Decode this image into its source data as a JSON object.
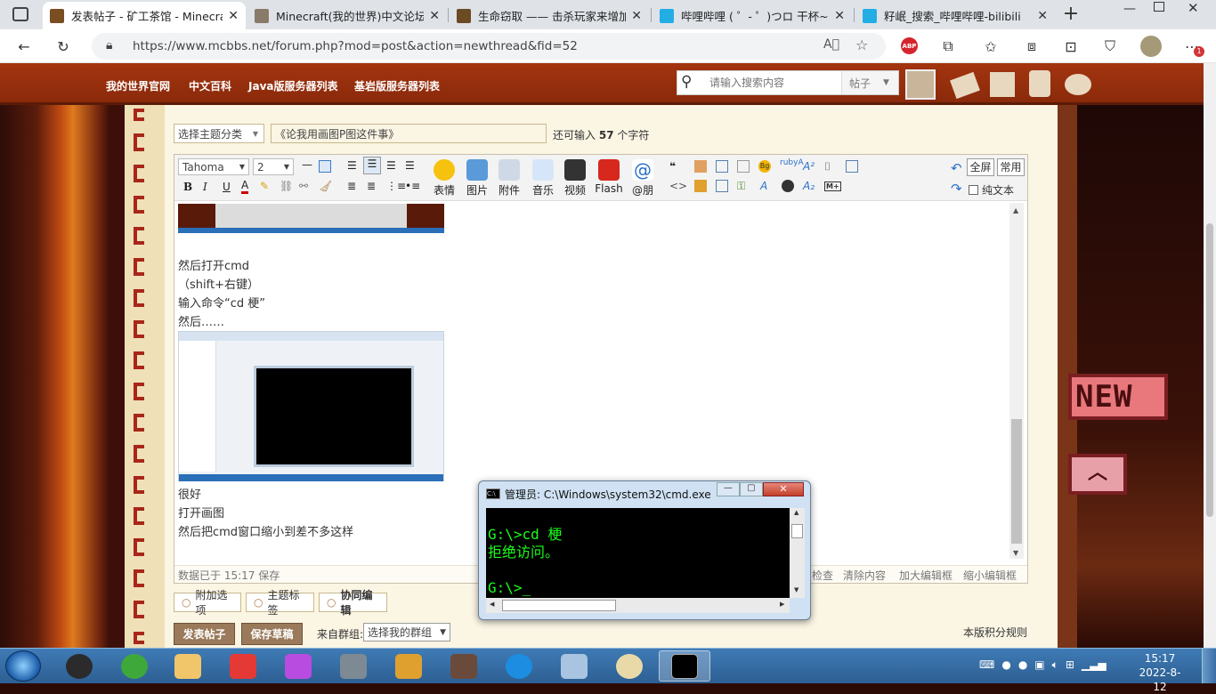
{
  "browser": {
    "tabs": [
      {
        "title": "发表帖子 - 矿工茶馆 - Minecra",
        "color": "#7a4e22",
        "active": true
      },
      {
        "title": "Minecraft(我的世界)中文论坛 -",
        "color": "#8a7a6a",
        "active": false
      },
      {
        "title": "生命窃取 —— 击杀玩家来增加",
        "color": "#6b4a24",
        "active": false
      },
      {
        "title": "哔哩哔哩 ( ゜- ゜)つロ 干杯~-b",
        "color": "#23ade5",
        "active": false
      },
      {
        "title": "籽岷_搜索_哔哩哔哩-bilibili",
        "color": "#23ade5",
        "active": false
      }
    ],
    "url": "https://www.mcbbs.net/forum.php?mod=post&action=newthread&fid=52",
    "abp_label": "ABP",
    "notif_count": "1"
  },
  "site": {
    "nav": [
      "我的世界官网",
      "中文百科",
      "Java版服务器列表",
      "基岩版服务器列表"
    ],
    "search_placeholder": "请输入搜索内容",
    "search_scope": "帖子"
  },
  "post": {
    "category_select": "选择主题分类",
    "subject": "《论我用画图P图这件事》",
    "remaining_prefix": "还可输入",
    "remaining_count": "57",
    "remaining_suffix": "个字符"
  },
  "toolbar": {
    "font_name": "Tahoma",
    "font_size": "2",
    "big_buttons": [
      "表情",
      "图片",
      "附件",
      "音乐",
      "视频",
      "Flash",
      "@朋"
    ],
    "fullscreen": "全屏",
    "common": "常用",
    "plaintext": "纯文本",
    "bold": "B",
    "italic": "I",
    "underline": "U",
    "color_a": "A"
  },
  "editor_body": {
    "lines_1": [
      "然后打开cmd",
      "（shift+右键）",
      "输入命令“cd 梗”",
      "然后……"
    ],
    "lines_2": [
      "很好",
      "打开画图",
      "然后把cmd窗口缩小到差不多这样"
    ]
  },
  "status": {
    "autosave": "数据已于 15:17 保存",
    "check": "检查",
    "clear": "清除内容",
    "enlarge": "加大编辑框",
    "shrink": "缩小编辑框"
  },
  "options": {
    "extra": "附加选项",
    "tags": "主题标签",
    "collab": "协同编辑"
  },
  "actions": {
    "submit": "发表帖子",
    "draft": "保存草稿",
    "group_label": "来自群组:",
    "group_select": "选择我的群组",
    "rules": "本版积分规则"
  },
  "cmd": {
    "title": "管理员: C:\\Windows\\system32\\cmd.exe",
    "lines": [
      "",
      "G:\\>cd 梗",
      "拒绝访问。",
      "",
      "G:\\>_"
    ]
  },
  "side_badges": {
    "new_label": "NEW"
  },
  "taskbar": {
    "time": "15:17",
    "date": "2022-8-12",
    "apps": [
      "qq",
      "360-browser",
      "file-explorer",
      "wps",
      "app-purple",
      "screen-tool",
      "kings",
      "game-chars",
      "edge",
      "network-computer",
      "paint",
      "cmd"
    ]
  }
}
